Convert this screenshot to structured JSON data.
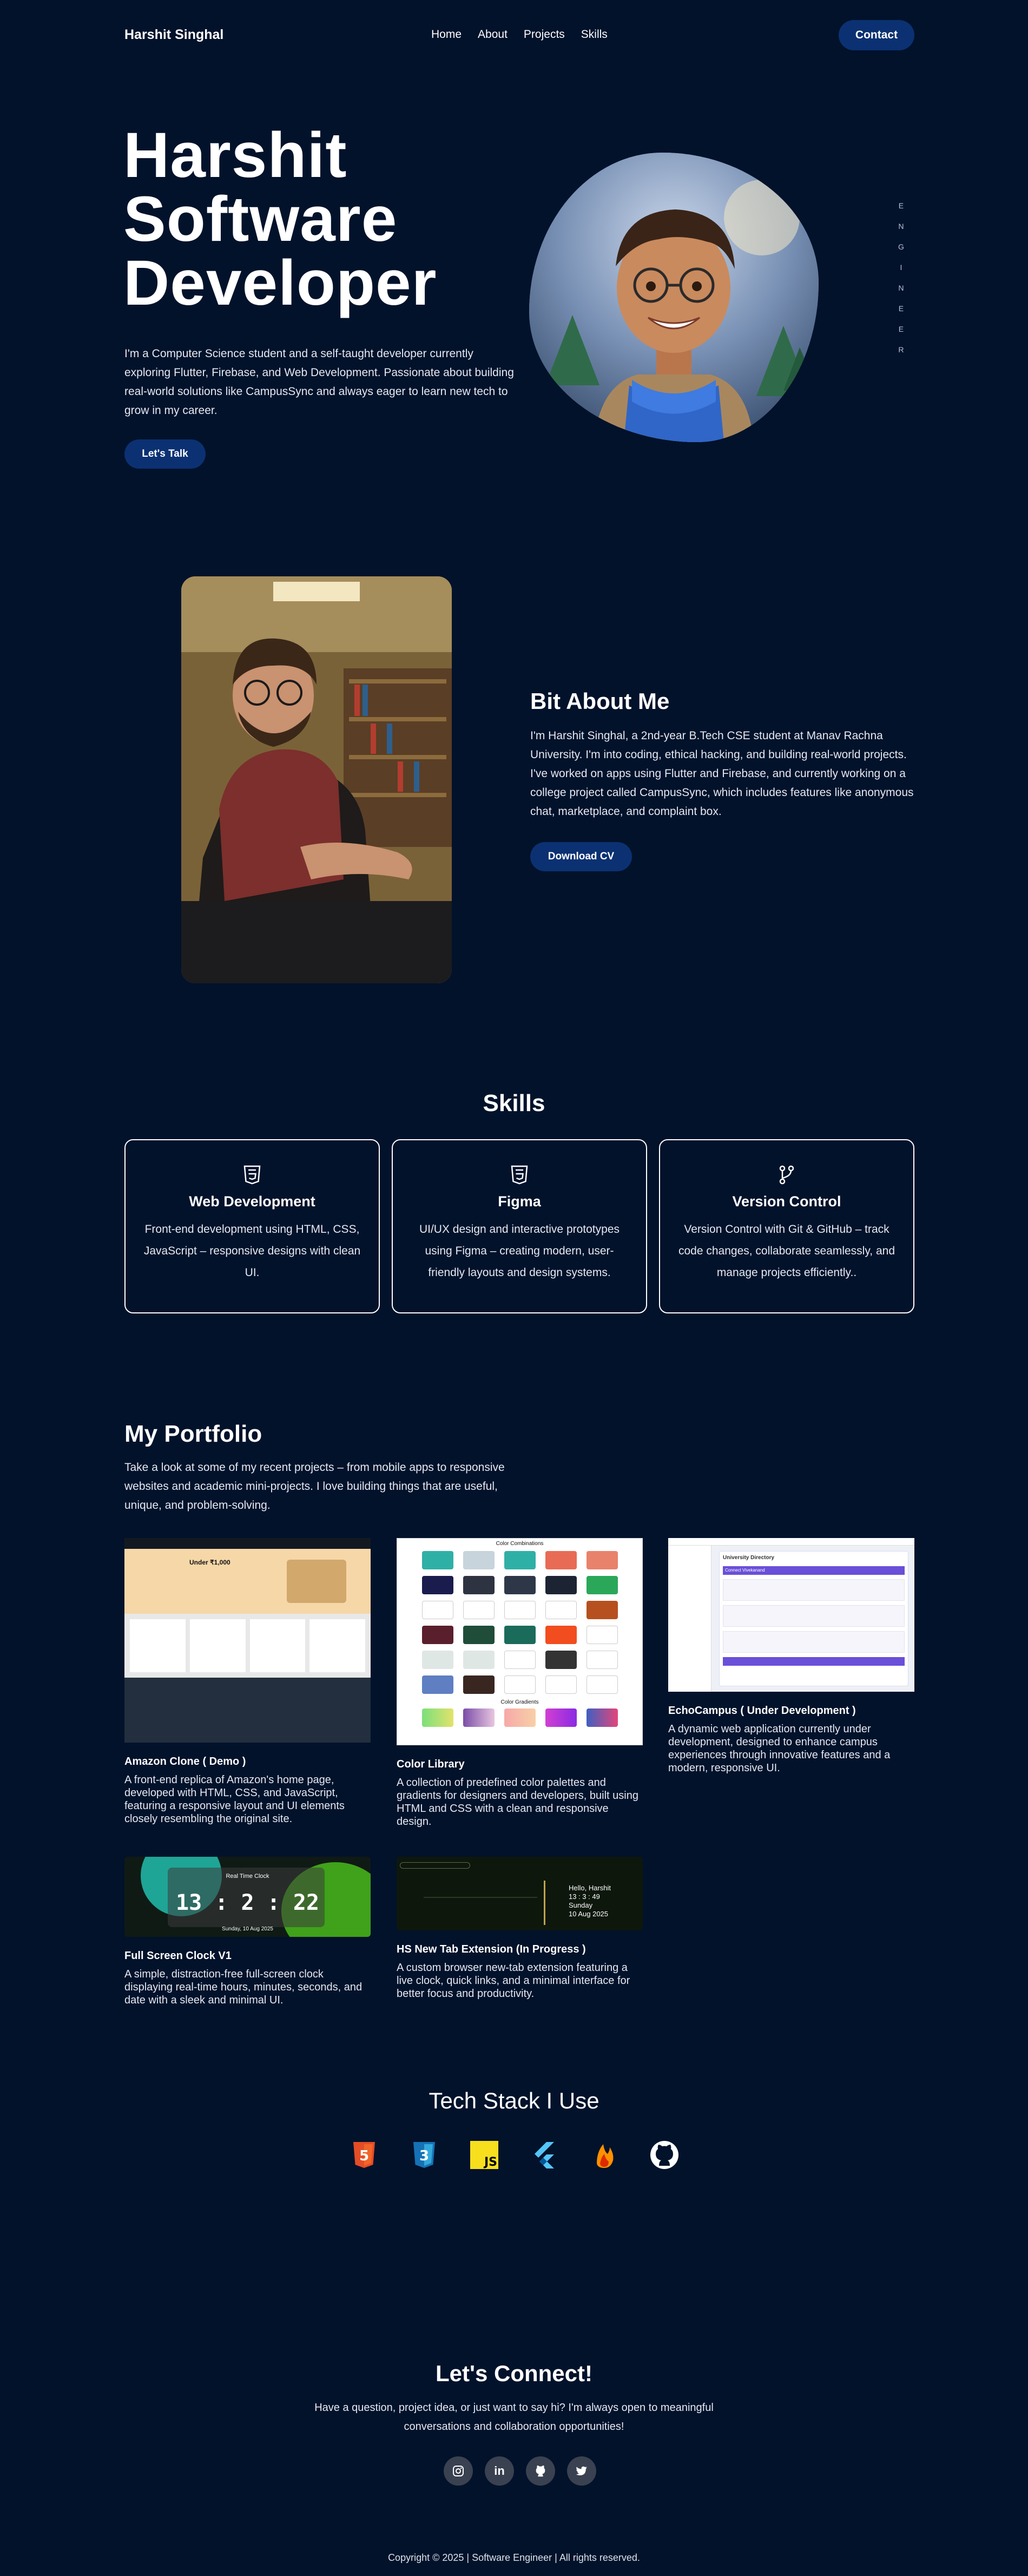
{
  "header": {
    "brand": "Harshit Singhal",
    "nav": [
      "Home",
      "About",
      "Projects",
      "Skills"
    ],
    "contact_label": "Contact"
  },
  "hero": {
    "title_lines": [
      "Harshit",
      "Software",
      "Developer"
    ],
    "description": "I'm a Computer Science student and a self-taught developer currently exploring Flutter, Firebase, and Web Development. Passionate about building real-world solutions like CampusSync and always eager to learn new tech to grow in my career.",
    "cta_label": "Let's Talk",
    "vertical_text": [
      "E",
      "N",
      "G",
      "I",
      "N",
      "E",
      "E",
      "R"
    ]
  },
  "about": {
    "title": "Bit About Me",
    "description": "I'm Harshit Singhal, a 2nd-year B.Tech CSE student at Manav Rachna University. I'm into coding, ethical hacking, and building real-world projects. I've worked on apps using Flutter and Firebase, and currently working on a college project called CampusSync, which includes features like anonymous chat, marketplace, and complaint box.",
    "cv_label": "Download CV"
  },
  "skills": {
    "title": "Skills",
    "cards": [
      {
        "name": "Web Development",
        "desc": "Front-end development using HTML, CSS, JavaScript – responsive designs with clean UI.",
        "icon": "html5-icon"
      },
      {
        "name": "Figma",
        "desc": "UI/UX design and interactive prototypes using Figma – creating modern, user-friendly layouts and design systems.",
        "icon": "html5-icon"
      },
      {
        "name": "Version Control",
        "desc": "Version Control with Git & GitHub – track code changes, collaborate seamlessly, and manage projects efficiently..",
        "icon": "git-branch-icon"
      }
    ]
  },
  "portfolio": {
    "title": "My Portfolio",
    "description": "Take a look at some of my recent projects – from mobile apps to responsive websites and academic mini-projects. I love building things that are useful, unique, and problem-solving.",
    "projects": [
      {
        "name": "Amazon Clone ( Demo )",
        "desc": "A front-end replica of Amazon's home page, developed with HTML, CSS, and JavaScript, featuring a responsive layout and UI elements closely resembling the original site."
      },
      {
        "name": "Color Library",
        "desc": "A collection of predefined color palettes and gradients for designers and developers, built using HTML and CSS with a clean and responsive design."
      },
      {
        "name": "EchoCampus ( Under Development )",
        "desc": "A dynamic web application currently under development, designed to enhance campus experiences through innovative features and a modern, responsive UI."
      },
      {
        "name": "Full Screen Clock V1",
        "desc": "A simple, distraction-free full-screen clock displaying real-time hours, minutes, seconds, and date with a sleek and minimal UI."
      },
      {
        "name": "HS New Tab Extension (In Progress )",
        "desc": "A custom browser new-tab extension featuring a live clock, quick links, and a minimal interface for better focus and productivity."
      }
    ],
    "thumbs": {
      "amazon_headline": "Under ₹1,000",
      "color_title": "Color Combinations",
      "color_gradients": "Color Gradients",
      "echo_title": "University Directory",
      "echo_section": "Connect Vivekanand",
      "clock_label": "Real Time Clock",
      "clock_time": "13 : 2 : 22",
      "clock_date": "Sunday, 10 Aug 2025",
      "newtab_greeting": "Hello, Harshit",
      "newtab_time": "13 : 3 : 49",
      "newtab_day": "Sunday",
      "newtab_date": "10 Aug 2025"
    }
  },
  "tech": {
    "title": "Tech Stack I Use",
    "icons": [
      "html5-icon",
      "css3-icon",
      "javascript-icon",
      "flutter-icon",
      "firebase-icon",
      "github-icon"
    ],
    "js_label": "JS",
    "html_num": "5",
    "css_num": "3"
  },
  "connect": {
    "title": "Let's Connect!",
    "description": "Have a question, project idea, or just want to say hi? I'm always open to meaningful conversations and collaboration opportunities!",
    "socials": [
      "instagram-icon",
      "linkedin-icon",
      "github-icon",
      "twitter-icon"
    ],
    "linkedin_text": "in"
  },
  "footer": {
    "text": "Copyright © 2025 | Software Engineer | All rights reserved."
  }
}
